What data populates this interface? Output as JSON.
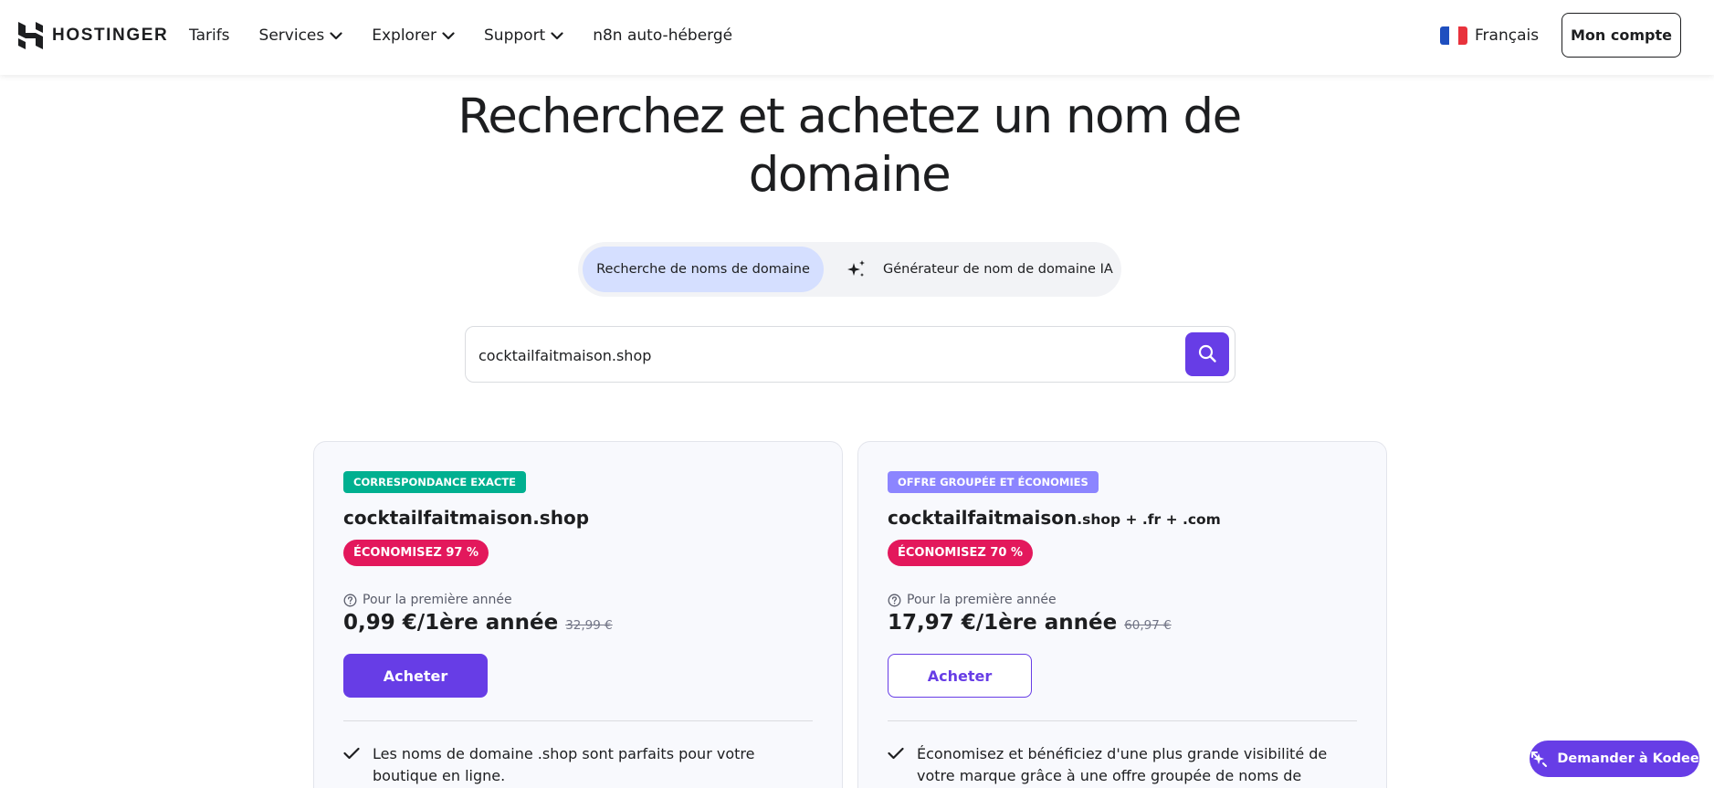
{
  "header": {
    "brand": "HOSTINGER",
    "nav": [
      {
        "label": "Tarifs",
        "has_dropdown": false
      },
      {
        "label": "Services",
        "has_dropdown": true
      },
      {
        "label": "Explorer",
        "has_dropdown": true
      },
      {
        "label": "Support",
        "has_dropdown": true
      },
      {
        "label": "n8n auto-hébergé",
        "has_dropdown": false
      }
    ],
    "language": "Français",
    "account_label": "Mon compte"
  },
  "hero": {
    "title_line1": "Recherchez et achetez un nom de",
    "title_line2": "domaine"
  },
  "tabs": {
    "search_label": "Recherche de noms de domaine",
    "ai_label": "Générateur de nom de domaine IA"
  },
  "search": {
    "value": "cocktailfaitmaison.shop"
  },
  "cards": [
    {
      "tag": "Correspondance exacte",
      "domain": "cocktailfaitmaison.shop",
      "domain_suffix": "",
      "discount": "Économisez 97 %",
      "first_year_label": "Pour la première année",
      "price": "0,99 €/1ère année",
      "old_price": "32,99 €",
      "buy_label": "Acheter",
      "feature": "Les noms de domaine .shop sont parfaits pour votre boutique en ligne."
    },
    {
      "tag": "Offre groupée et économies",
      "domain": "cocktailfaitmaison",
      "domain_suffix": ".shop + .fr + .com",
      "discount": "Économisez 70 %",
      "first_year_label": "Pour la première année",
      "price": "17,97 €/1ère année",
      "old_price": "60,97 €",
      "buy_label": "Acheter",
      "feature": "Économisez et bénéficiez d'une plus grande visibilité de votre marque grâce à une offre groupée de noms de domaine."
    }
  ],
  "assistant": {
    "label": "Demander à Kodee"
  },
  "colors": {
    "primary": "#673de6",
    "exact_tag": "#00b090",
    "bundle_tag": "#8c85ff",
    "discount": "#e3185c",
    "active_tab": "#d5dfff"
  }
}
